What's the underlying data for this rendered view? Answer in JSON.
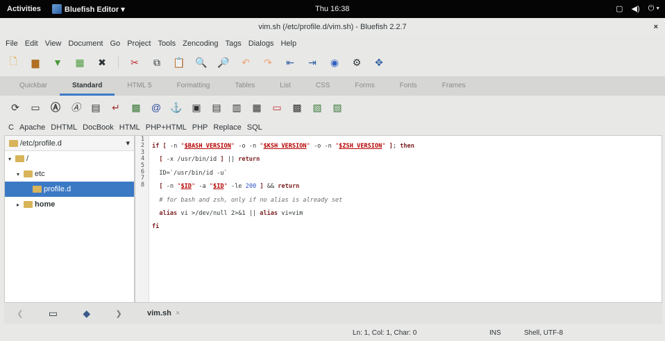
{
  "system": {
    "activities": "Activities",
    "app_name": "Bluefish Editor ▾",
    "clock": "Thu 16:38"
  },
  "window": {
    "title": "vim.sh (/etc/profile.d/vim.sh) - Bluefish 2.2.7",
    "close": "×"
  },
  "menu": [
    "File",
    "Edit",
    "View",
    "Document",
    "Go",
    "Project",
    "Tools",
    "Zencoding",
    "Tags",
    "Dialogs",
    "Help"
  ],
  "tabs": [
    "Quickbar",
    "Standard",
    "HTML 5",
    "Formatting",
    "Tables",
    "List",
    "CSS",
    "Forms",
    "Fonts",
    "Frames"
  ],
  "active_tab": "Standard",
  "snippets": [
    "C",
    "Apache",
    "DHTML",
    "DocBook",
    "HTML",
    "PHP+HTML",
    "PHP",
    "Replace",
    "SQL"
  ],
  "sidebar": {
    "path": "/etc/profile.d",
    "root": "/",
    "etc": "etc",
    "profile": "profile.d",
    "home": "home"
  },
  "editor": {
    "line_numbers": [
      "1",
      "2",
      "3",
      "4",
      "5",
      "6",
      "7",
      "8"
    ]
  },
  "doc_tab": {
    "name": "vim.sh",
    "close": "×"
  },
  "status": {
    "position": "Ln: 1, Col: 1, Char: 0",
    "mode": "INS",
    "filetype": "Shell, UTF-8"
  },
  "colors": {
    "accent": "#3b79c5",
    "topbar": "#050505"
  }
}
